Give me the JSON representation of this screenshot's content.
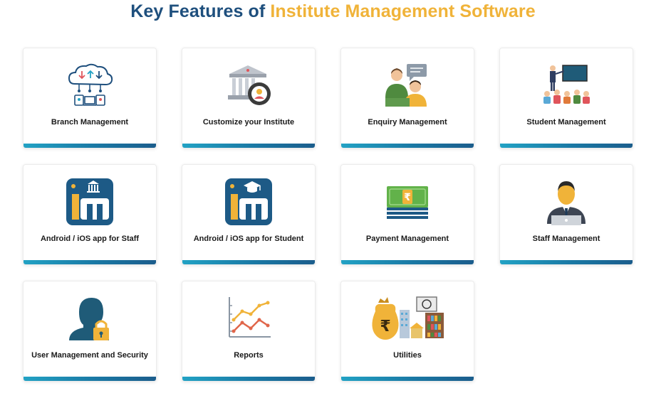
{
  "header": {
    "title_prefix": "Key Features of",
    "title_accent": "Institute Management Software"
  },
  "features": [
    {
      "label": "Branch Management"
    },
    {
      "label": "Customize your Institute"
    },
    {
      "label": "Enquiry Management"
    },
    {
      "label": "Student Management"
    },
    {
      "label": "Android / iOS app for Staff"
    },
    {
      "label": "Android / iOS app for Student"
    },
    {
      "label": "Payment Management"
    },
    {
      "label": "Staff Management"
    },
    {
      "label": "User Management and Security"
    },
    {
      "label": "Reports"
    },
    {
      "label": "Utilities"
    }
  ],
  "colors": {
    "title": "#1e4f7d",
    "accent": "#f0b339",
    "bar_start": "#22a2c4",
    "bar_end": "#1b5d8c"
  }
}
